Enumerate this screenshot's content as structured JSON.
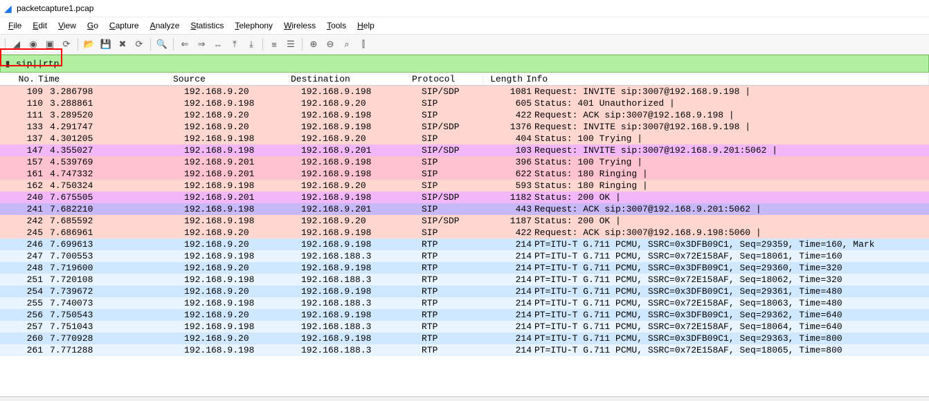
{
  "title": "packetcapture1.pcap",
  "menu": [
    "File",
    "Edit",
    "View",
    "Go",
    "Capture",
    "Analyze",
    "Statistics",
    "Telephony",
    "Wireless",
    "Tools",
    "Help"
  ],
  "filter": "sip||rtp",
  "columns": [
    "No.",
    "Time",
    "Source",
    "Destination",
    "Protocol",
    "Length",
    "Info"
  ],
  "rows": [
    {
      "cls": "sip1",
      "no": "109",
      "time": "3.286798",
      "src": "192.168.9.20",
      "dst": "192.168.9.198",
      "proto": "SIP/SDP",
      "len": "1081",
      "info": "Request: INVITE sip:3007@192.168.9.198 |"
    },
    {
      "cls": "sip1",
      "no": "110",
      "time": "3.288861",
      "src": "192.168.9.198",
      "dst": "192.168.9.20",
      "proto": "SIP",
      "len": "605",
      "info": "Status: 401 Unauthorized |"
    },
    {
      "cls": "sip1",
      "no": "111",
      "time": "3.289520",
      "src": "192.168.9.20",
      "dst": "192.168.9.198",
      "proto": "SIP",
      "len": "422",
      "info": "Request: ACK sip:3007@192.168.9.198 |"
    },
    {
      "cls": "sip1",
      "no": "133",
      "time": "4.291747",
      "src": "192.168.9.20",
      "dst": "192.168.9.198",
      "proto": "SIP/SDP",
      "len": "1376",
      "info": "Request: INVITE sip:3007@192.168.9.198 |"
    },
    {
      "cls": "sip1",
      "no": "137",
      "time": "4.301205",
      "src": "192.168.9.198",
      "dst": "192.168.9.20",
      "proto": "SIP",
      "len": "404",
      "info": "Status: 100 Trying |"
    },
    {
      "cls": "sip3",
      "no": "147",
      "time": "4.355027",
      "src": "192.168.9.198",
      "dst": "192.168.9.201",
      "proto": "SIP/SDP",
      "len": "103",
      "info": "Request: INVITE sip:3007@192.168.9.201:5062 |"
    },
    {
      "cls": "sip2",
      "no": "157",
      "time": "4.539769",
      "src": "192.168.9.201",
      "dst": "192.168.9.198",
      "proto": "SIP",
      "len": "396",
      "info": "Status: 100 Trying |"
    },
    {
      "cls": "sip2",
      "no": "161",
      "time": "4.747332",
      "src": "192.168.9.201",
      "dst": "192.168.9.198",
      "proto": "SIP",
      "len": "622",
      "info": "Status: 180 Ringing |"
    },
    {
      "cls": "sip1",
      "no": "162",
      "time": "4.750324",
      "src": "192.168.9.198",
      "dst": "192.168.9.20",
      "proto": "SIP",
      "len": "593",
      "info": "Status: 180 Ringing |"
    },
    {
      "cls": "sip3",
      "no": "240",
      "time": "7.675505",
      "src": "192.168.9.201",
      "dst": "192.168.9.198",
      "proto": "SIP/SDP",
      "len": "1182",
      "info": "Status: 200 OK |"
    },
    {
      "cls": "sip4",
      "no": "241",
      "time": "7.682210",
      "src": "192.168.9.198",
      "dst": "192.168.9.201",
      "proto": "SIP",
      "len": "443",
      "info": "Request: ACK sip:3007@192.168.9.201:5062 |"
    },
    {
      "cls": "sip1",
      "no": "242",
      "time": "7.685592",
      "src": "192.168.9.198",
      "dst": "192.168.9.20",
      "proto": "SIP/SDP",
      "len": "1187",
      "info": "Status: 200 OK |"
    },
    {
      "cls": "sip1",
      "no": "245",
      "time": "7.686961",
      "src": "192.168.9.20",
      "dst": "192.168.9.198",
      "proto": "SIP",
      "len": "422",
      "info": "Request: ACK sip:3007@192.168.9.198:5060 |"
    },
    {
      "cls": "rtp1",
      "no": "246",
      "time": "7.699613",
      "src": "192.168.9.20",
      "dst": "192.168.9.198",
      "proto": "RTP",
      "len": "214",
      "info": "PT=ITU-T G.711 PCMU, SSRC=0x3DFB09C1, Seq=29359, Time=160, Mark"
    },
    {
      "cls": "rtp2",
      "no": "247",
      "time": "7.700553",
      "src": "192.168.9.198",
      "dst": "192.168.188.3",
      "proto": "RTP",
      "len": "214",
      "info": "PT=ITU-T G.711 PCMU, SSRC=0x72E158AF, Seq=18061, Time=160"
    },
    {
      "cls": "rtp1",
      "no": "248",
      "time": "7.719600",
      "src": "192.168.9.20",
      "dst": "192.168.9.198",
      "proto": "RTP",
      "len": "214",
      "info": "PT=ITU-T G.711 PCMU, SSRC=0x3DFB09C1, Seq=29360, Time=320"
    },
    {
      "cls": "rtp2",
      "no": "251",
      "time": "7.720108",
      "src": "192.168.9.198",
      "dst": "192.168.188.3",
      "proto": "RTP",
      "len": "214",
      "info": "PT=ITU-T G.711 PCMU, SSRC=0x72E158AF, Seq=18062, Time=320"
    },
    {
      "cls": "rtp1",
      "no": "254",
      "time": "7.739672",
      "src": "192.168.9.20",
      "dst": "192.168.9.198",
      "proto": "RTP",
      "len": "214",
      "info": "PT=ITU-T G.711 PCMU, SSRC=0x3DFB09C1, Seq=29361, Time=480"
    },
    {
      "cls": "rtp2",
      "no": "255",
      "time": "7.740073",
      "src": "192.168.9.198",
      "dst": "192.168.188.3",
      "proto": "RTP",
      "len": "214",
      "info": "PT=ITU-T G.711 PCMU, SSRC=0x72E158AF, Seq=18063, Time=480"
    },
    {
      "cls": "rtp1",
      "no": "256",
      "time": "7.750543",
      "src": "192.168.9.20",
      "dst": "192.168.9.198",
      "proto": "RTP",
      "len": "214",
      "info": "PT=ITU-T G.711 PCMU, SSRC=0x3DFB09C1, Seq=29362, Time=640"
    },
    {
      "cls": "rtp2",
      "no": "257",
      "time": "7.751043",
      "src": "192.168.9.198",
      "dst": "192.168.188.3",
      "proto": "RTP",
      "len": "214",
      "info": "PT=ITU-T G.711 PCMU, SSRC=0x72E158AF, Seq=18064, Time=640"
    },
    {
      "cls": "rtp1",
      "no": "260",
      "time": "7.770928",
      "src": "192.168.9.20",
      "dst": "192.168.9.198",
      "proto": "RTP",
      "len": "214",
      "info": "PT=ITU-T G.711 PCMU, SSRC=0x3DFB09C1, Seq=29363, Time=800"
    },
    {
      "cls": "rtp2",
      "no": "261",
      "time": "7.771288",
      "src": "192.168.9.198",
      "dst": "192.168.188.3",
      "proto": "RTP",
      "len": "214",
      "info": "PT=ITU-T G.711 PCMU, SSRC=0x72E158AF, Seq=18065, Time=800"
    }
  ],
  "toolbar_icons": [
    "shark-fin-icon",
    "circle-icon",
    "stop-icon",
    "restart-icon",
    "folder-open-icon",
    "save-icon",
    "close-icon",
    "reload-icon",
    "search-icon",
    "arrow-left-icon",
    "arrow-right-icon",
    "jump-icon",
    "go-first-icon",
    "go-last-icon",
    "autoscroll-icon",
    "colorize-icon",
    "zoom-in-icon",
    "zoom-out-icon",
    "zoom-reset-icon",
    "resize-cols-icon"
  ],
  "toolbar_glyphs": [
    "◢",
    "◉",
    "▣",
    "⟳",
    "📂",
    "💾",
    "✖",
    "⟳",
    "🔍",
    "⇐",
    "⇒",
    "⇔",
    "⤒",
    "⤓",
    "≡",
    "☰",
    "⊕",
    "⊖",
    "⌕",
    "⫿"
  ]
}
